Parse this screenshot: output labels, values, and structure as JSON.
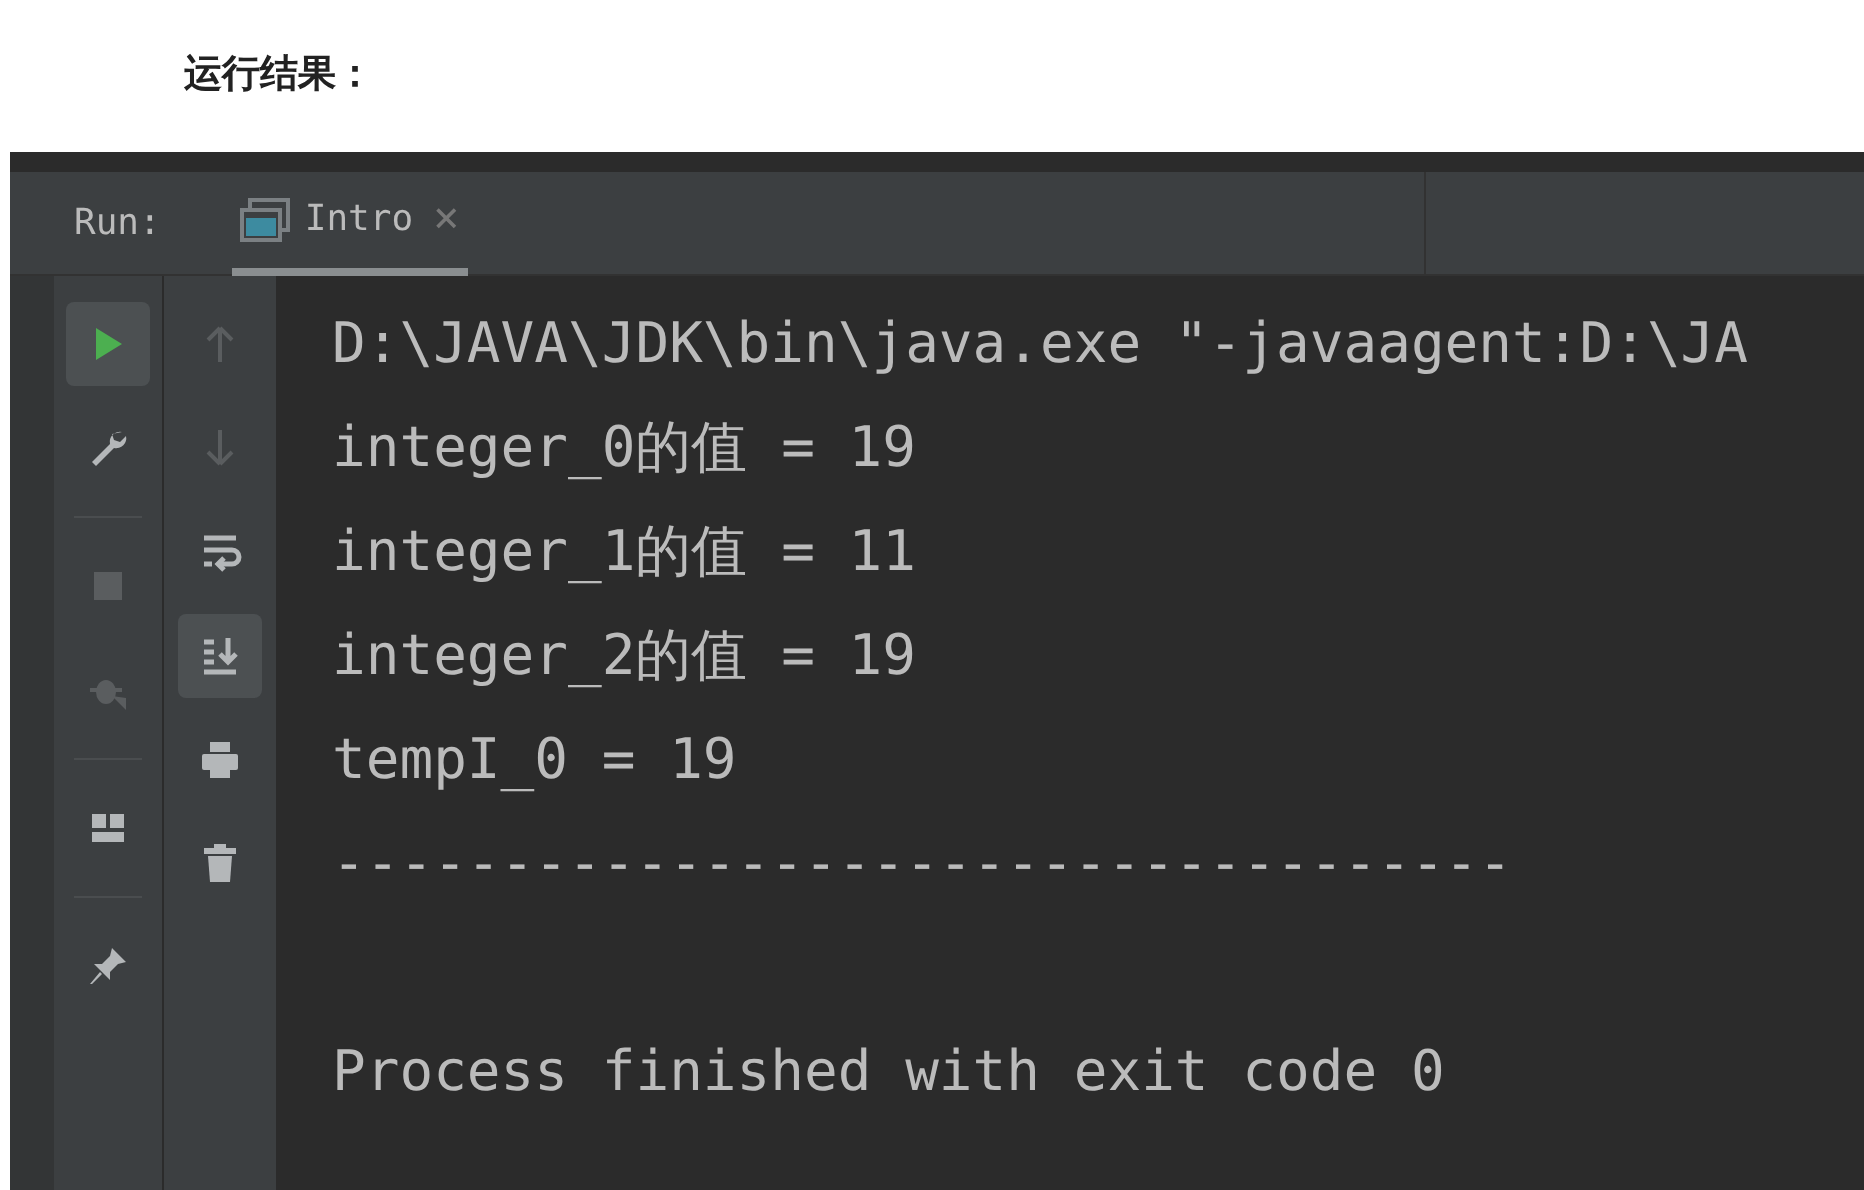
{
  "heading": "运行结果：",
  "run_panel": {
    "label": "Run:",
    "tab": {
      "label": "Intro",
      "selected": true,
      "close": "×"
    }
  },
  "left_toolbar": [
    {
      "kind": "run",
      "selected": true,
      "disabled": false
    },
    {
      "kind": "wrench",
      "selected": false,
      "disabled": false
    },
    {
      "kind": "divider"
    },
    {
      "kind": "stop",
      "selected": false,
      "disabled": true
    },
    {
      "kind": "debug",
      "selected": false,
      "disabled": true
    },
    {
      "kind": "divider"
    },
    {
      "kind": "layout",
      "selected": false,
      "disabled": false
    },
    {
      "kind": "divider"
    },
    {
      "kind": "pin",
      "selected": false,
      "disabled": false
    }
  ],
  "right_toolbar": [
    {
      "kind": "up",
      "selected": false,
      "disabled": true
    },
    {
      "kind": "down",
      "selected": false,
      "disabled": true
    },
    {
      "kind": "wrap",
      "selected": false,
      "disabled": false
    },
    {
      "kind": "scroll-end",
      "selected": true,
      "disabled": false
    },
    {
      "kind": "print",
      "selected": false,
      "disabled": false
    },
    {
      "kind": "trash",
      "selected": false,
      "disabled": false
    }
  ],
  "console_lines": [
    {
      "text": "D:\\JAVA\\JDK\\bin\\java.exe \"-javaagent:D:\\JA",
      "blank_before": false
    },
    {
      "text": "integer_0的值 = 19",
      "blank_before": false
    },
    {
      "text": "integer_1的值 = 11",
      "blank_before": false
    },
    {
      "text": "integer_2的值 = 19",
      "blank_before": false
    },
    {
      "text": "tempI_0 = 19",
      "blank_before": false
    },
    {
      "text": "-----------------------------------",
      "blank_before": false
    },
    {
      "text": "Process finished with exit code 0",
      "blank_before": true
    }
  ]
}
